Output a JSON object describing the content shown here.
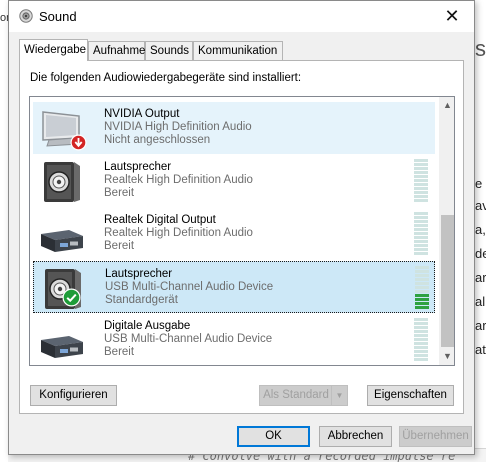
{
  "background": {
    "left_text": "on",
    "right_chars": [
      "s",
      "e",
      "av",
      "a,",
      "de",
      "ar",
      "al",
      "ar",
      "at"
    ],
    "code_line": "# Convolve with a recorded impulse re"
  },
  "window": {
    "title": "Sound",
    "close_glyph": "✕"
  },
  "tabs": [
    {
      "label": "Wiedergabe",
      "active": true
    },
    {
      "label": "Aufnahme",
      "active": false
    },
    {
      "label": "Sounds",
      "active": false
    },
    {
      "label": "Kommunikation",
      "active": false
    }
  ],
  "panel": {
    "heading": "Die folgenden Audiowiedergabegeräte sind installiert:"
  },
  "devices": [
    {
      "name": "NVIDIA Output",
      "description": "NVIDIA High Definition Audio",
      "status": "Nicht angeschlossen",
      "icon": "monitor-icon",
      "state": "disconnected",
      "level": 0
    },
    {
      "name": "Lautsprecher",
      "description": "Realtek High Definition Audio",
      "status": "Bereit",
      "icon": "speaker-icon",
      "state": "ready",
      "level": 0
    },
    {
      "name": "Realtek Digital Output",
      "description": "Realtek High Definition Audio",
      "status": "Bereit",
      "icon": "digital-output-icon",
      "state": "ready",
      "level": 0
    },
    {
      "name": "Lautsprecher",
      "description": "USB Multi-Channel Audio Device",
      "status": "Standardgerät",
      "icon": "speaker-icon",
      "state": "default",
      "level": 0.4
    },
    {
      "name": "Digitale Ausgabe",
      "description": "USB Multi-Channel Audio Device",
      "status": "Bereit",
      "icon": "digital-output-icon",
      "state": "ready",
      "level": 0
    }
  ],
  "buttons": {
    "configure": "Konfigurieren",
    "set_default": "Als Standard",
    "properties": "Eigenschaften",
    "ok": "OK",
    "cancel": "Abbrechen",
    "apply": "Übernehmen"
  },
  "colors": {
    "selection": "#cde8f7",
    "level_on": "#2fa240",
    "level_off": "#cfe3e1",
    "default_check": "#1e9c39",
    "disconnected_badge": "#d32424"
  }
}
